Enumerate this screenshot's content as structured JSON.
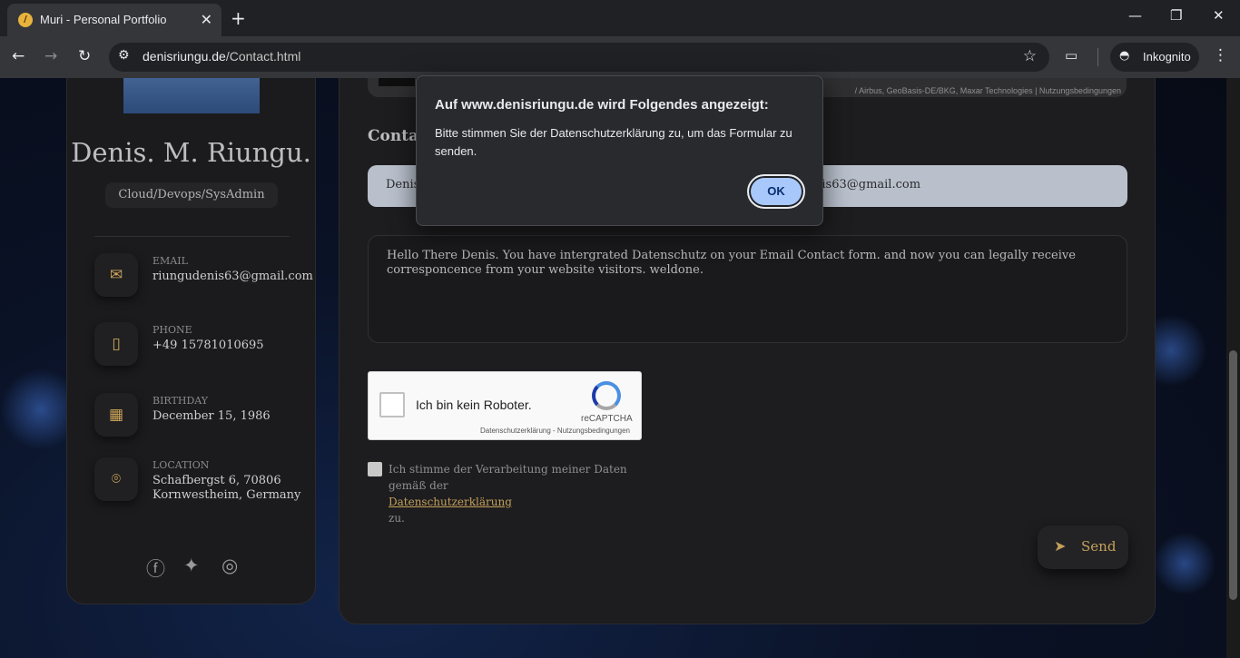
{
  "browser": {
    "tab_title": "Muri - Personal Portfolio",
    "tab_close": "✕",
    "new_tab": "+",
    "url_host": "denisriungu.de",
    "url_path": "/Contact.html",
    "incognito_label": "Inkognito",
    "window_controls": {
      "minimize": "—",
      "restore": "❐",
      "close": "✕"
    }
  },
  "sidebar": {
    "name": "Denis. M. Riungu.",
    "role": "Cloud/Devops/SysAdmin",
    "contacts": [
      {
        "label": "Email",
        "value": "riungudenis63@gmail.com",
        "icon": "mail-icon"
      },
      {
        "label": "Phone",
        "value": "+49 15781010695",
        "icon": "phone-icon"
      },
      {
        "label": "Birthday",
        "value": "December 15, 1986",
        "icon": "calendar-icon"
      },
      {
        "label": "Location",
        "value": "Schafbergst 6, 70806 Kornwestheim, Germany",
        "icon": "location-pin-icon"
      }
    ],
    "social": [
      "facebook-icon",
      "twitter-icon",
      "instagram-icon"
    ]
  },
  "main": {
    "map_attribution": "/ Airbus, GeoBasis-DE/BKG, Maxar Technologies  |  Nutzungsbedingungen",
    "contact_title": "Contac",
    "fullname_value": "Denis",
    "email_value": "nis63@gmail.com",
    "message_value": "Hello There Denis. You have intergrated Datenschutz on your Email Contact form. and now you can legally receive corresponcence from your website visitors. weldone.",
    "recaptcha": {
      "label": "Ich bin kein Roboter.",
      "brand": "reCAPTCHA",
      "terms": "Datenschutzerklärung - Nutzungsbedingungen"
    },
    "consent": {
      "text_before": "Ich stimme der Verarbeitung meiner Daten gemäß der",
      "link": "Datenschutzerklärung",
      "text_after": "zu."
    },
    "send_label": "Send"
  },
  "dialog": {
    "title": "Auf www.denisriungu.de wird Folgendes angezeigt:",
    "message": "Bitte stimmen Sie der Datenschutzerklärung zu, um das Formular zu senden.",
    "ok_label": "OK"
  },
  "colors": {
    "accent_gold": "#c4a05b",
    "dialog_button": "#a8c7fa",
    "panel_bg": "#1d1d1f"
  }
}
